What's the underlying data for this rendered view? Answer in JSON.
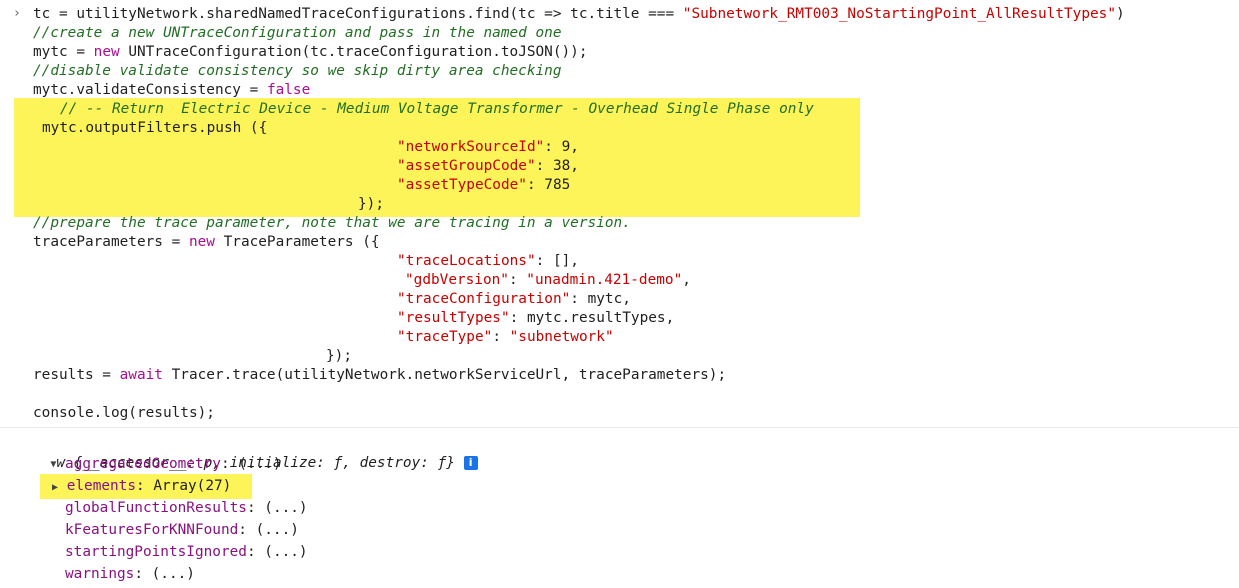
{
  "console": {
    "prompt_glyph": "›",
    "code": {
      "l1_a": "tc = utilityNetwork.sharedNamedTraceConfigurations.find(tc => tc.title === ",
      "l1_str": "\"Subnetwork_RMT003_NoStartingPoint_AllResultTypes\"",
      "l1_b": ")",
      "l2": "//create a new UNTraceConfiguration and pass in the named one",
      "l3_a": "mytc = ",
      "l3_kw": "new",
      "l3_b": " UNTraceConfiguration(tc.traceConfiguration.toJSON());",
      "l4": "//disable validate consistency so we skip dirty area checking",
      "l5_a": "mytc.validateConsistency = ",
      "l5_kw": "false",
      "l6": "// -- Return  Electric Device - Medium Voltage Transformer - Overhead Single Phase only",
      "l7": "mytc.outputFilters.push ({",
      "l8_key": "\"networkSourceId\"",
      "l8_val": ": 9,",
      "l9_key": "\"assetGroupCode\"",
      "l9_val": ": 38,",
      "l10_key": "\"assetTypeCode\"",
      "l10_val": ": 785",
      "l11": "});",
      "l12": "//prepare the trace parameter, note that we are tracing in a version.",
      "l13_a": "traceParameters = ",
      "l13_kw": "new",
      "l13_b": " TraceParameters ({",
      "l14_key": "\"traceLocations\"",
      "l14_val": ": [],",
      "l15_key": "\"gdbVersion\"",
      "l15_sep": ": ",
      "l15_str": "\"unadmin.421-demo\"",
      "l15_end": ",",
      "l16_key": "\"traceConfiguration\"",
      "l16_val": ": mytc,",
      "l17_key": "\"resultTypes\"",
      "l17_val": ": mytc.resultTypes,",
      "l18_key": "\"traceType\"",
      "l18_sep": ": ",
      "l18_str": "\"subnetwork\"",
      "l19": "});",
      "l20_a": "results = ",
      "l20_kw": "await",
      "l20_b": " Tracer.trace(utilityNetwork.networkServiceUrl, traceParameters);",
      "l21": "console.log(results);"
    },
    "output": {
      "object_summary": "w {__accessor__: p, initialize: ƒ, destroy: ƒ}",
      "info_badge": "i",
      "properties": [
        {
          "key": "aggregatedGeometry",
          "value": ": (...)"
        },
        {
          "key": "elements",
          "value": ": Array(27)"
        },
        {
          "key": "globalFunctionResults",
          "value": ": (...)"
        },
        {
          "key": "kFeaturesForKNNFound",
          "value": ": (...)"
        },
        {
          "key": "startingPointsIgnored",
          "value": ": (...)"
        },
        {
          "key": "warnings",
          "value": ": (...)"
        }
      ]
    },
    "highlight_color": "#fcf459"
  }
}
